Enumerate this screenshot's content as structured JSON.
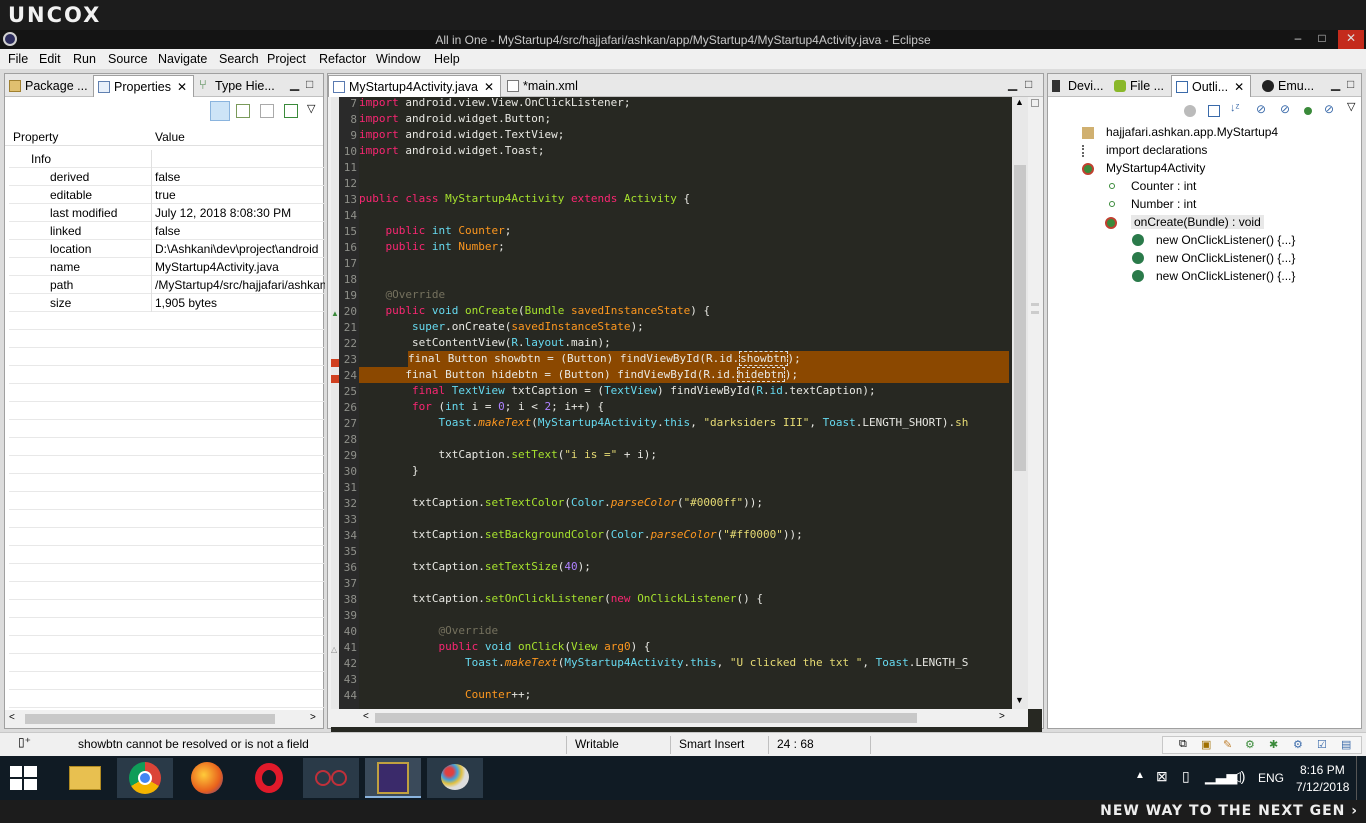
{
  "brand": "UNCOX",
  "tagline": "NEW WAY TO THE NEXT GEN ›",
  "window": {
    "title": "All in One - MyStartup4/src/hajjafari/ashkan/app/MyStartup4/MyStartup4Activity.java - Eclipse",
    "min": "–",
    "max": "□",
    "close": "✕"
  },
  "menu": [
    "File",
    "Edit",
    "Run",
    "Source",
    "Navigate",
    "Search",
    "Project",
    "Refactor",
    "Window",
    "Help"
  ],
  "left_panel": {
    "tabs": [
      {
        "label": "Package ..."
      },
      {
        "label": "Properties"
      },
      {
        "label": "Type Hie..."
      }
    ],
    "columns": {
      "property": "Property",
      "value": "Value"
    },
    "category": "Info",
    "rows": [
      {
        "key": "derived",
        "value": "false"
      },
      {
        "key": "editable",
        "value": "true"
      },
      {
        "key": "last modified",
        "value": "July 12, 2018 8:08:30 PM"
      },
      {
        "key": "linked",
        "value": "false"
      },
      {
        "key": "location",
        "value": "D:\\Ashkani\\dev\\project\\android"
      },
      {
        "key": "name",
        "value": "MyStartup4Activity.java"
      },
      {
        "key": "path",
        "value": "/MyStartup4/src/hajjafari/ashkan"
      },
      {
        "key": "size",
        "value": "1,905  bytes"
      }
    ]
  },
  "editor": {
    "tabs": [
      {
        "label": "MyStartup4Activity.java"
      },
      {
        "label": "*main.xml"
      }
    ],
    "line_numbers": [
      "7",
      "8",
      "9",
      "10",
      "11",
      "12",
      "13",
      "14",
      "15",
      "16",
      "17",
      "18",
      "19",
      "20",
      "21",
      "22",
      "23",
      "24",
      "25",
      "26",
      "27",
      "28",
      "29",
      "30",
      "31",
      "32",
      "33",
      "34",
      "35",
      "36",
      "37",
      "38",
      "39",
      "40",
      "41",
      "42",
      "43",
      "44"
    ]
  },
  "right_panel": {
    "tabs": [
      {
        "label": "Devi..."
      },
      {
        "label": "File ..."
      },
      {
        "label": "Outli..."
      },
      {
        "label": "Emu..."
      }
    ],
    "outline": [
      {
        "label": "hajjafari.ashkan.app.MyStartup4"
      },
      {
        "label": "import declarations"
      },
      {
        "label": "MyStartup4Activity"
      },
      {
        "label": "Counter : int"
      },
      {
        "label": "Number : int"
      },
      {
        "label": "onCreate(Bundle) : void"
      },
      {
        "label": "new OnClickListener() {...}"
      },
      {
        "label": "new OnClickListener() {...}"
      },
      {
        "label": "new OnClickListener() {...}"
      }
    ]
  },
  "status": {
    "message": "showbtn cannot be resolved or is not a field",
    "writable": "Writable",
    "insert_mode": "Smart Insert",
    "position": "24 : 68"
  },
  "taskbar": {
    "language": "ENG",
    "time": "8:16 PM",
    "date": "7/12/2018"
  }
}
